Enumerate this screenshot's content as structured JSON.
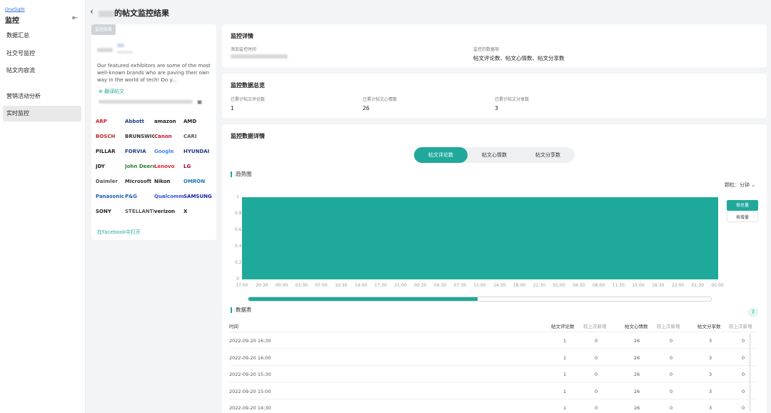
{
  "sidebar": {
    "brand": "OneSight",
    "title": "监控",
    "items": [
      {
        "label": "数据汇总"
      },
      {
        "label": "社交号监控"
      },
      {
        "label": "帖文内容流"
      },
      {
        "label": "营销活动分析"
      },
      {
        "label": "实时监控"
      }
    ]
  },
  "header": {
    "title": "的帖文监控结果"
  },
  "post": {
    "tag": "监控结束",
    "text": "Our featured exhibitors are some of the most well-known brands who are paving their own way in the world of tech! Do y...",
    "translate_label": "翻译帖文",
    "facebook_link": "在Facebook中打开",
    "logos": [
      "ARP",
      "Abbott",
      "amazon",
      "AMD",
      "BOSCH",
      "BRUNSWICK",
      "Canon",
      "CARI",
      "PILLAR",
      "FORVIA",
      "Google",
      "HYUNDAI",
      "JDY",
      "John Deere",
      "Lenovo",
      "LG",
      "Daimler",
      "Microsoft",
      "Nikon",
      "OMRON",
      "Panasonic",
      "P&G",
      "Qualcomm",
      "SAMSUNG",
      "SONY",
      "STELLANTIS",
      "verizon",
      "X"
    ]
  },
  "monitor_detail": {
    "title": "监控详情",
    "add_time_label": "添加监控时间",
    "data_items_label": "监控的数据项",
    "data_items_value": "帖文评论数、帖文心情数、帖文分享数"
  },
  "summary": {
    "title": "监控数据总览",
    "metrics": [
      {
        "label": "已累计帖文评论数",
        "value": "1"
      },
      {
        "label": "已累计帖文心情数",
        "value": "26"
      },
      {
        "label": "已累计帖文分享数",
        "value": "3"
      }
    ]
  },
  "detail": {
    "title": "监控数据详情",
    "tabs": [
      {
        "label": "帖文评论数",
        "active": true
      },
      {
        "label": "帖文心情数",
        "active": false
      },
      {
        "label": "帖文分享数",
        "active": false
      }
    ],
    "trend_label": "趋势图",
    "granularity": "颗粒：分钟",
    "mode_cumulative": "按总量",
    "mode_incremental": "按增量",
    "table_label": "数据表"
  },
  "chart_data": {
    "type": "bar",
    "y_ticks": [
      "1",
      "0.8",
      "0.6",
      "0.4",
      "0.2",
      "0"
    ],
    "ylim": [
      0,
      1
    ],
    "x_ticks": [
      "17:00",
      "20:30",
      "00:00",
      "03:30",
      "07:00",
      "10:30",
      "14:00",
      "17:30",
      "21:00",
      "00:30",
      "04:30",
      "07:30",
      "11:00",
      "14:30",
      "18:00",
      "21:30",
      "01:00",
      "04:30",
      "08:00",
      "11:30",
      "15:00",
      "18:30",
      "22:00",
      "01:30",
      "05:00"
    ],
    "values": [
      1,
      1,
      1,
      1,
      1,
      1,
      1,
      1,
      1,
      1,
      1,
      1,
      1,
      1,
      1,
      1,
      1,
      1,
      1,
      1,
      1,
      1,
      1,
      1
    ],
    "grid": false,
    "color": "#1fa99a"
  },
  "data_table": {
    "columns": [
      "时间",
      "帖文评论数",
      "较上次新增",
      "帖文心情数",
      "较上次新增",
      "帖文分享数",
      "较上次新增"
    ],
    "rows": [
      [
        "2022-09-20 16:30",
        "1",
        "0",
        "26",
        "0",
        "3",
        "0"
      ],
      [
        "2022-09-20 16:00",
        "1",
        "0",
        "26",
        "0",
        "3",
        "0"
      ],
      [
        "2022-09-20 15:30",
        "1",
        "0",
        "26",
        "0",
        "3",
        "0"
      ],
      [
        "2022-09-20 15:00",
        "1",
        "0",
        "26",
        "0",
        "3",
        "0"
      ],
      [
        "2022-09-20 14:30",
        "1",
        "0",
        "26",
        "0",
        "3",
        "0"
      ]
    ]
  },
  "colors": {
    "accent": "#20a99a",
    "background": "#f3f4f6"
  }
}
